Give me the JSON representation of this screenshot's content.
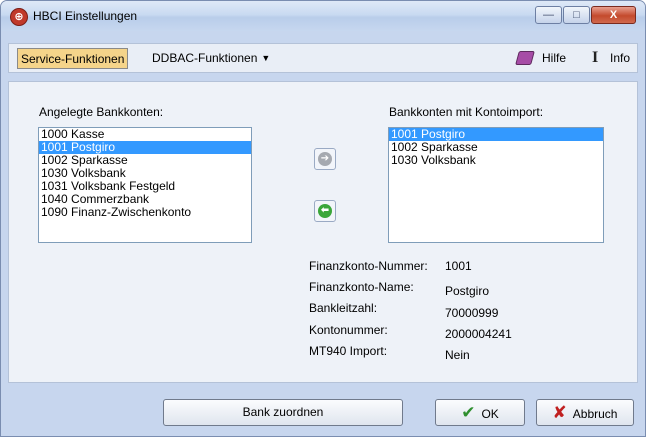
{
  "window": {
    "title": "HBCI Einstellungen",
    "controls": {
      "minimize": "—",
      "maximize": "□",
      "close": "X"
    }
  },
  "menubar": {
    "service": "Service-Funktionen",
    "ddbac": "DDBAC-Funktionen",
    "hilfe": "Hilfe",
    "info": "Info"
  },
  "left_list": {
    "label": "Angelegte Bankkonten:",
    "items": [
      "1000 Kasse",
      "1001 Postgiro",
      "1002 Sparkasse",
      "1030 Volksbank",
      "1031 Volksbank Festgeld",
      "1040 Commerzbank",
      "1090 Finanz-Zwischenkonto"
    ],
    "selected_index": 1
  },
  "right_list": {
    "label": "Bankkonten mit Kontoimport:",
    "items": [
      "1001 Postgiro",
      "1002 Sparkasse",
      "1030 Volksbank"
    ],
    "selected_index": 0
  },
  "details": {
    "number_label": "Finanzkonto-Nummer:",
    "number_value": "1001",
    "name_label": "Finanzkonto-Name:",
    "name_value": "Postgiro",
    "blz_label": "Bankleitzahl:",
    "blz_value": "70000999",
    "account_label": "Kontonummer:",
    "account_value": "2000004241",
    "mt940_label": "MT940 Import:",
    "mt940_value": "Nein"
  },
  "buttons": {
    "assign": "Bank zuordnen",
    "ok": "OK",
    "cancel": "Abbruch"
  },
  "colors": {
    "selection": "#3399ff",
    "menu_highlight": "#f5d48a",
    "window_frame": "#c7d6ee"
  }
}
